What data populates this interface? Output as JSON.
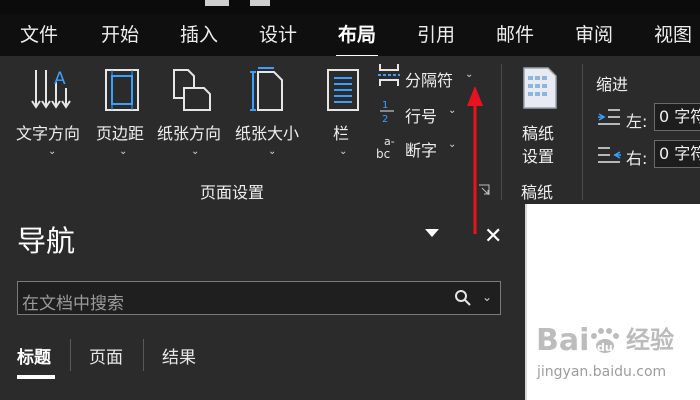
{
  "tabs": {
    "items": [
      "文件",
      "开始",
      "插入",
      "设计",
      "布局",
      "引用",
      "邮件",
      "审阅",
      "视图"
    ],
    "active": "布局"
  },
  "ribbon": {
    "page_setup": {
      "text_direction": "文字方向",
      "margins": "页边距",
      "orientation": "纸张方向",
      "size": "纸张大小",
      "columns": "栏",
      "breaks": "分隔符",
      "line_numbers": "行号",
      "hyphenation": "断字",
      "group_label": "页面设置"
    },
    "manuscript": {
      "button_line1": "稿纸",
      "button_line2": "设置",
      "group_label": "稿纸"
    },
    "indent": {
      "title": "缩进",
      "left_label": "左:",
      "left_value": "0 字符",
      "right_label": "右:",
      "right_value": "0 字符"
    }
  },
  "nav_pane": {
    "title": "导航",
    "search_placeholder": "在文档中搜索",
    "tabs": [
      "标题",
      "页面",
      "结果"
    ],
    "active_tab": "标题"
  },
  "watermark": {
    "brand": "Bai",
    "brand_suffix": "du",
    "cn": "经验",
    "url": "jingyan.baidu.com"
  },
  "colors": {
    "arrow": "#e8131f",
    "ribbon_bg": "#2b2b2b",
    "tab_bg": "#0f0f0f"
  }
}
